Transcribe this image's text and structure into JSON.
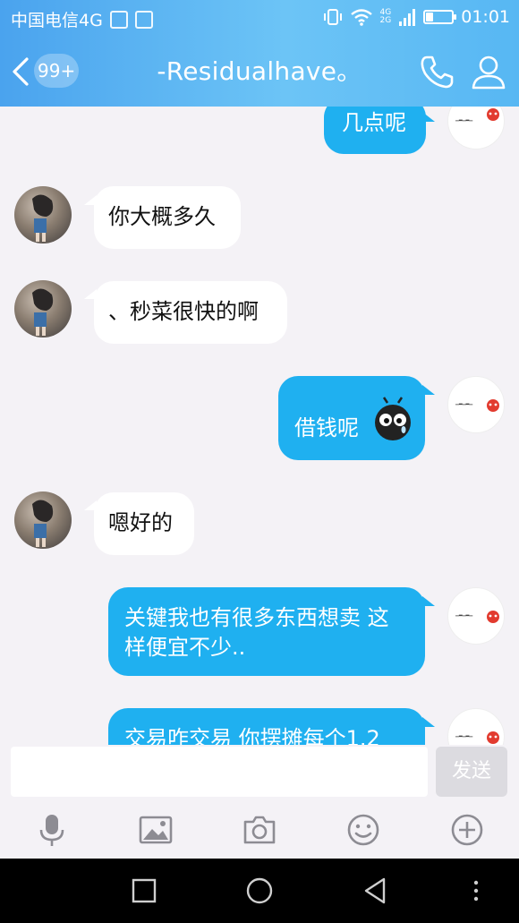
{
  "status_bar": {
    "carrier": "中国电信4G",
    "network_top": "4G",
    "network_bottom": "2G",
    "battery_level": 0.3,
    "time": "01:01"
  },
  "header": {
    "unread_badge": "99+",
    "title": "-Residualhave。"
  },
  "messages": [
    {
      "side": "out",
      "text": "几点呢"
    },
    {
      "side": "in",
      "text": "你大概多久"
    },
    {
      "side": "in",
      "text": "、秒菜很快的啊"
    },
    {
      "side": "out",
      "text": "借钱呢"
    },
    {
      "side": "in",
      "text": "嗯好的"
    },
    {
      "side": "out",
      "line1": "关键我也有很多东西想卖 这",
      "line2": "样便宜不少.."
    },
    {
      "side": "out",
      "text": "交易咋交易 你摆摊每个1.2"
    }
  ],
  "input": {
    "value": "",
    "send_label": "发送"
  },
  "colors": {
    "header_blue": "#4aa3ee",
    "outgoing_bubble": "#1fb0f0",
    "incoming_bubble": "#ffffff",
    "chat_bg": "#f4f2f6"
  },
  "icons": {
    "toolbar": [
      "microphone-icon",
      "image-icon",
      "camera-icon",
      "emoji-icon",
      "plus-icon"
    ],
    "nav": [
      "recents-icon",
      "home-icon",
      "back-triangle-icon",
      "more-icon"
    ]
  }
}
